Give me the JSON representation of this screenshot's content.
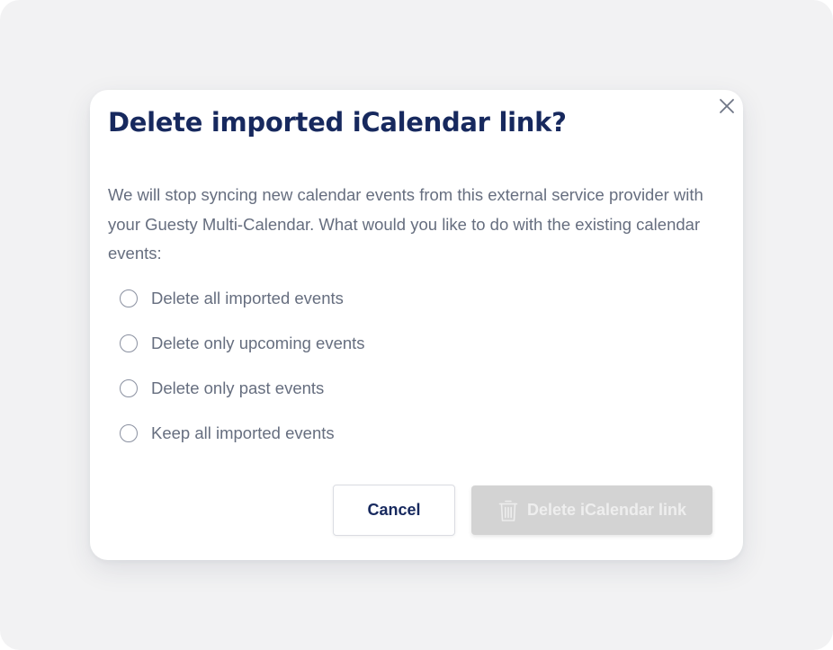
{
  "dialog": {
    "title": "Delete imported iCalendar link?",
    "close_icon": "close-icon",
    "description": "We will stop syncing new calendar events from this external service provider with your Guesty Multi-Calendar. What would you like to do with the existing calendar events:",
    "options": [
      {
        "label": "Delete all imported events",
        "selected": false
      },
      {
        "label": "Delete only upcoming events",
        "selected": false
      },
      {
        "label": "Delete only past events",
        "selected": false
      },
      {
        "label": "Keep all imported events",
        "selected": false
      }
    ],
    "buttons": {
      "cancel_label": "Cancel",
      "delete_label": "Delete iCalendar link",
      "delete_icon": "trash-icon",
      "delete_disabled": true
    }
  },
  "colors": {
    "title": "#17295e",
    "body_text": "#666e7f",
    "backdrop": "#f2f2f3",
    "disabled_button": "#d3d3d3"
  }
}
